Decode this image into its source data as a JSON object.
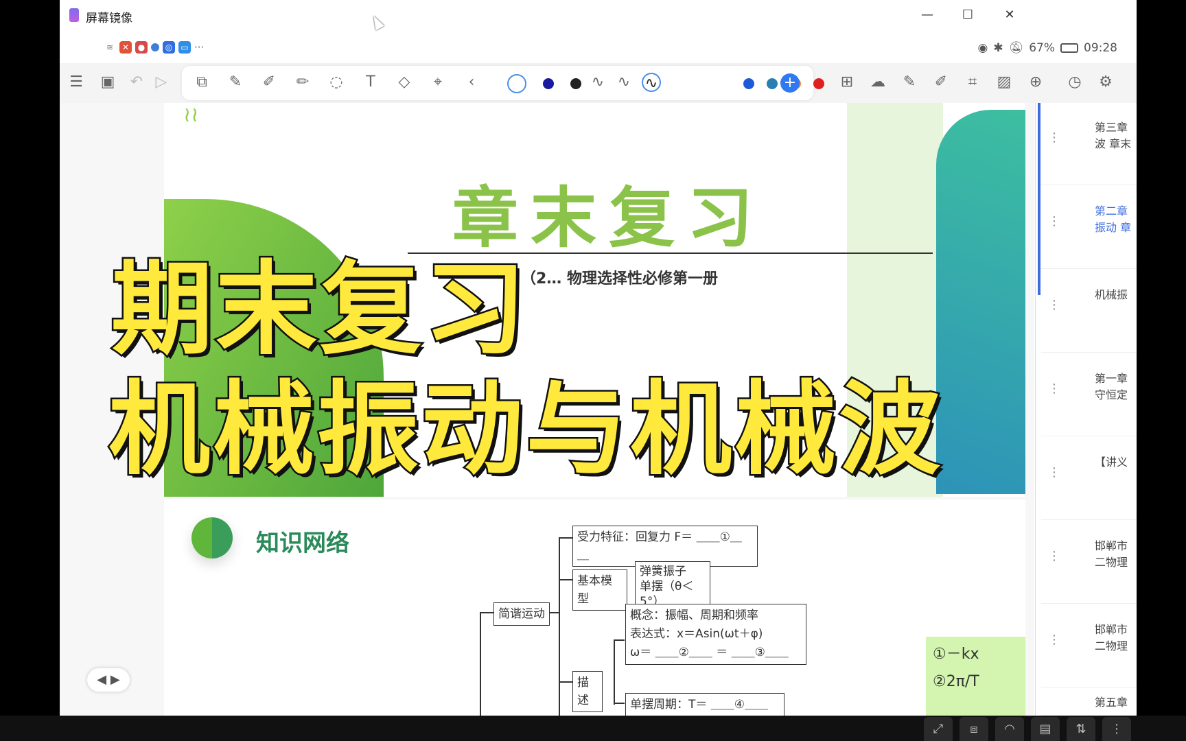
{
  "window": {
    "app_title": "屏幕镜像",
    "minimize": "—",
    "maximize": "☐",
    "close": "✕"
  },
  "statusbar": {
    "more": "···",
    "battery": "67%",
    "time": "09:28"
  },
  "toolbar": {
    "icons": [
      "menu-icon",
      "file-icon",
      "undo-icon",
      "redo-icon",
      "layout-icon",
      "pen-icon",
      "marker-icon",
      "highlighter-icon",
      "lasso-icon",
      "text-icon",
      "shape-icon",
      "pointer-icon",
      "back-icon",
      "circle-color-icon",
      "wave-icon",
      "add-icon",
      "grid-icon",
      "cloud-icon",
      "pencil-icon",
      "eraser-icon",
      "crop-icon",
      "image-icon",
      "add-page-icon",
      "clock-icon",
      "settings-icon"
    ],
    "colors": [
      "#1a1aa0",
      "#222222",
      "#1d5bd6",
      "#2a7fb0",
      "#f08a30",
      "#e02020"
    ],
    "add_label": "+"
  },
  "slide1": {
    "title": "章末复习",
    "subtitle": "（2…    物理选择性必修第一册"
  },
  "slide2": {
    "section_title": "知识网络",
    "nodes": {
      "force": "受力特征：回复力 F＝ ＿＿①＿＿",
      "model": "基本模型",
      "spring": "弹簧振子",
      "pendulum": "单摆（θ＜5°）",
      "shm": "简谐运动",
      "concept": "概念：振幅、周期和频率",
      "expression": "表达式：x＝Asin(ωt＋φ)",
      "omega": "ω＝ ＿＿②＿＿ ＝ ＿＿③＿＿",
      "describe": "描述",
      "period": "单摆周期：T＝ ＿＿④＿＿"
    },
    "answers": [
      "①－kx",
      "②2π/T"
    ]
  },
  "nav": {
    "prev": "◀",
    "next": "▶"
  },
  "sidebar": {
    "items": [
      "第三章\n波 章末",
      "第二章\n振动 章",
      "机械振",
      "第一章\n守恒定",
      "【讲义",
      "邯郸市\n二物理",
      "邯郸市\n二物理",
      "第五章"
    ]
  },
  "overlay": {
    "line1": "期末复习",
    "line2": "机械振动与机械波"
  }
}
